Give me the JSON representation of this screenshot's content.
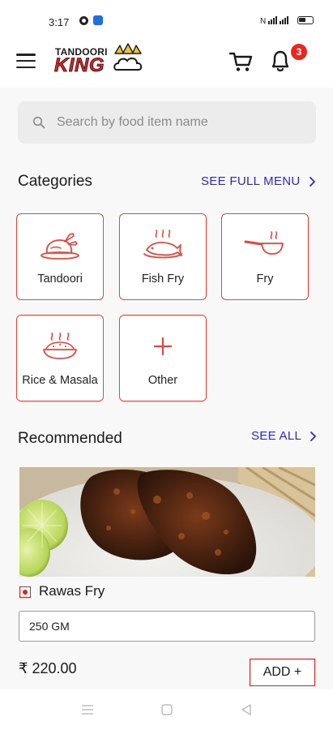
{
  "status_bar": {
    "time": "3:17",
    "right_text": "Ⓝ ¹ᴴ⁴ᴸ"
  },
  "header": {
    "logo_top": "TANDOORI",
    "logo_main": "KING",
    "notification_count": "3"
  },
  "search": {
    "placeholder": "Search by food item name"
  },
  "categories": {
    "title": "Categories",
    "link": "SEE FULL MENU",
    "items": [
      {
        "label": "Tandoori",
        "icon": "roast-chicken-icon"
      },
      {
        "label": "Fish Fry",
        "icon": "fish-plate-icon"
      },
      {
        "label": "Fry",
        "icon": "frying-pan-icon"
      },
      {
        "label": "Rice & Masala",
        "icon": "rice-bowl-icon"
      },
      {
        "label": "Other",
        "icon": "plus-icon"
      }
    ]
  },
  "recommended": {
    "title": "Recommended",
    "link": "SEE ALL",
    "item": {
      "name": "Rawas Fry",
      "quantity": "250 GM",
      "price": "₹ 220.00",
      "add_label": "ADD +"
    }
  },
  "colors": {
    "accent": "#e8453c",
    "link": "#2a2ad0",
    "badge": "#e8281f"
  }
}
